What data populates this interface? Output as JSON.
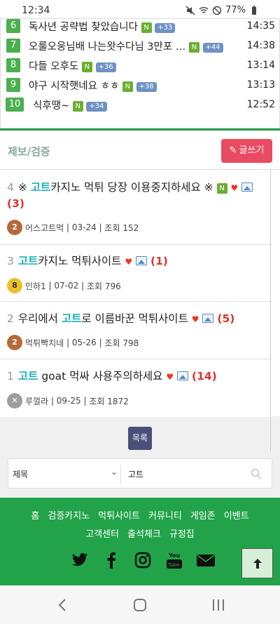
{
  "status_bar": {
    "time": "12:34",
    "battery": "77%"
  },
  "popular": [
    {
      "rank": "6",
      "title": "독사년 공략법 찾았습니다",
      "new": "N",
      "count": "+33",
      "time": "14:35"
    },
    {
      "rank": "7",
      "title": "오룰오웅님배 나는왓수다님 3만포 …",
      "new": "N",
      "count": "+44",
      "time": "14:38"
    },
    {
      "rank": "8",
      "title": "다들 오후도",
      "new": "N",
      "count": "+36",
      "time": "13:14"
    },
    {
      "rank": "9",
      "title": "야구 시작햇네요 ㅎㅎ",
      "new": "N",
      "count": "+38",
      "time": "13:13"
    },
    {
      "rank": "10",
      "title": "식후땡~",
      "new": "N",
      "count": "+34",
      "time": "12:52"
    }
  ],
  "board": {
    "title": "제보/검증",
    "write_label": "글쓰기",
    "posts": [
      {
        "num": "4",
        "prefix": "※ ",
        "keyword": "고트",
        "rest": "카지노 먹튀 당장 이용중지하세요 ※",
        "new": "N",
        "comments": "(3)",
        "author": "어스고트먹",
        "date": "03-24",
        "views": "조회 152",
        "level": "2"
      },
      {
        "num": "3",
        "prefix": "",
        "keyword": "고트",
        "rest": "카지노 먹튀사이트",
        "comments": "(1)",
        "author": "인하1",
        "date": "07-02",
        "views": "조회 796",
        "level": "8"
      },
      {
        "num": "2",
        "prefix": "우리에서 ",
        "keyword": "고트",
        "rest": "로 이름바꾼 먹튀사이트",
        "comments": "(5)",
        "author": "먹튀빡치네",
        "date": "05-26",
        "views": "조회 798",
        "level": "2"
      },
      {
        "num": "1",
        "prefix": "",
        "keyword": "고트",
        "rest": " goat 먹싸 사용주의하세요",
        "comments": "(14)",
        "author": "루껄라",
        "date": "09-25",
        "views": "조회 1872",
        "level": "x"
      }
    ],
    "list_label": "목록"
  },
  "search": {
    "field": "제목",
    "value": "고트"
  },
  "footer": {
    "links_row1": [
      "홈",
      "검증카지노",
      "먹튀사이트",
      "커뮤니티",
      "게임존",
      "이벤트"
    ],
    "links_row2": [
      "고객센터",
      "출석체크",
      "규정집"
    ],
    "socials": [
      "twitter-icon",
      "facebook-icon",
      "instagram-icon",
      "youtube-icon",
      "mail-icon"
    ]
  },
  "colors": {
    "green": "#22a34a",
    "write": "#e94b62",
    "keyword": "#1ab0b9",
    "comment": "#d9362b"
  }
}
